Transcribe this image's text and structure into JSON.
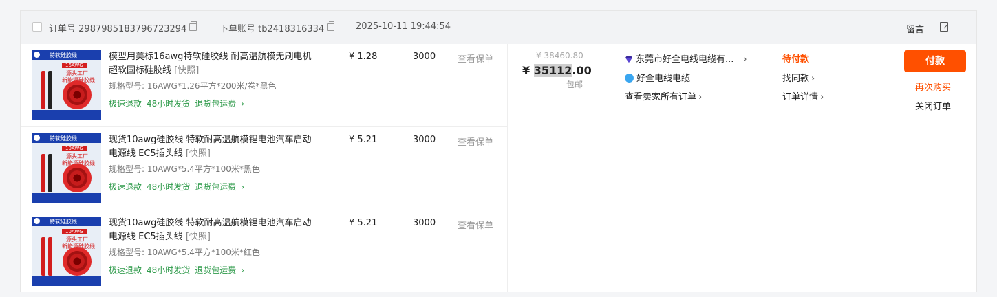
{
  "header": {
    "order_no_label": "订单号",
    "order_no": "2987985183796723294",
    "account_label": "下单账号",
    "account": "tb2418316334",
    "time": "2025-10-11 19:44:54",
    "message": "留言"
  },
  "items": [
    {
      "title": "模型用美标16awg特软硅胶线 耐高温航模无刷电机超软国标硅胶线",
      "snapshot": "[快照]",
      "spec": "规格型号: 16AWG*1.26平方*200米/卷*黑色",
      "services": [
        "极速退款",
        "48小时发货",
        "退货包运费"
      ],
      "price": "¥ 1.28",
      "qty": "3000",
      "insurance": "查看保单",
      "thumb_brand": "特软硅胶线",
      "thumb_tag": "16AWG",
      "thumb_l1": "源头工厂",
      "thumb_l2": "新能源硅胶线"
    },
    {
      "title": "现货10awg硅胶线 特软耐高温航模锂电池汽车启动电源线 EC5插头线",
      "snapshot": "[快照]",
      "spec": "规格型号: 10AWG*5.4平方*100米*黑色",
      "services": [
        "极速退款",
        "48小时发货",
        "退货包运费"
      ],
      "price": "¥ 5.21",
      "qty": "3000",
      "insurance": "查看保单",
      "thumb_brand": "特软硅胶线",
      "thumb_tag": "10AWG",
      "thumb_l1": "源头工厂",
      "thumb_l2": "新能源硅胶线"
    },
    {
      "title": "现货10awg硅胶线 特软耐高温航模锂电池汽车启动电源线 EC5插头线",
      "snapshot": "[快照]",
      "spec": "规格型号: 10AWG*5.4平方*100米*红色",
      "services": [
        "极速退款",
        "48小时发货",
        "退货包运费"
      ],
      "price": "¥ 5.21",
      "qty": "3000",
      "insurance": "查看保单",
      "thumb_brand": "特软硅胶线",
      "thumb_tag": "10AWG",
      "thumb_l1": "源头工厂",
      "thumb_l2": "新能源硅胶线"
    }
  ],
  "summary": {
    "original_price": "¥ 38460.80",
    "currency": "¥",
    "total": "35112",
    "total_cents": ".00",
    "shipping": "包邮"
  },
  "seller": {
    "shop_name": "东莞市好全电线电缆有...",
    "store": "好全电线电缆",
    "all_orders": "查看卖家所有订单"
  },
  "status": {
    "text": "待付款",
    "find_same": "找同款",
    "order_detail": "订单详情"
  },
  "actions": {
    "pay": "付款",
    "rebuy": "再次购买",
    "close": "关闭订单"
  },
  "colors": {
    "accent": "#ff5000",
    "service_green": "#2e9a4a"
  }
}
